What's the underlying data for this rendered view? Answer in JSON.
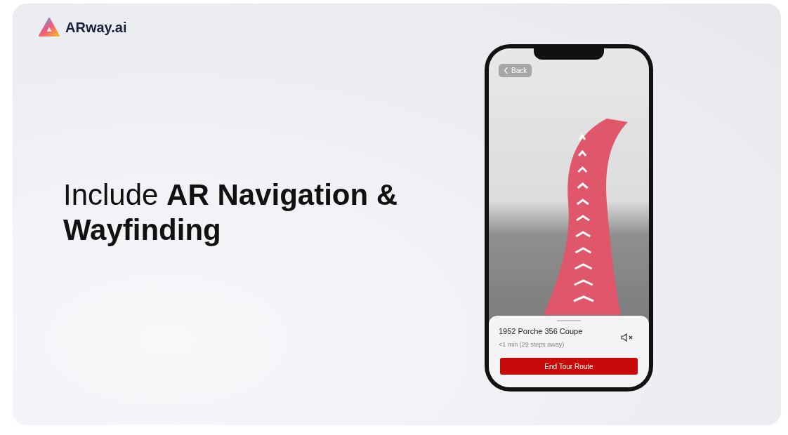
{
  "brand": {
    "name": "ARway.ai"
  },
  "headline": "Include **AR Navigation & Wayfinding**",
  "phone": {
    "back_button": "Back",
    "destination": {
      "title": "1952 Porche 356 Coupe",
      "eta": "<1 min (29 steps away)"
    },
    "end_button": "End Tour Route"
  }
}
